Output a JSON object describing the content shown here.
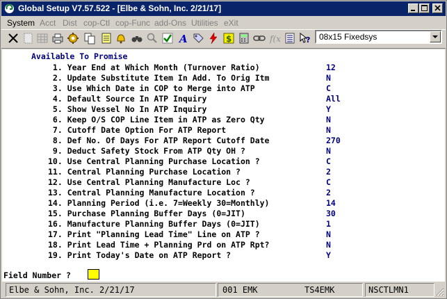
{
  "window": {
    "title": "Global Setup V7.57.522 - [Elbe & Sohn, Inc. 2/21/17]"
  },
  "menubar": {
    "items": [
      {
        "label": "System",
        "enabled": true
      },
      {
        "label": "Acct",
        "enabled": false
      },
      {
        "label": "Dist",
        "enabled": false
      },
      {
        "label": "cop-Ctl",
        "enabled": false
      },
      {
        "label": "cop-Func",
        "enabled": false
      },
      {
        "label": "add-Ons",
        "enabled": false
      },
      {
        "label": "Utilities",
        "enabled": false
      },
      {
        "label": "eXit",
        "enabled": false
      }
    ]
  },
  "toolbar": {
    "font_select": "08x15 Fixedsys"
  },
  "screen": {
    "heading": "Available To Promise",
    "rows": [
      {
        "q": " 1. Year End at Which Month (Turnover Ratio)",
        "v": "12"
      },
      {
        "q": " 2. Update Substitute Item In Add. To Orig Itm",
        "v": "N"
      },
      {
        "q": " 3. Use Which Date in COP to Merge into ATP",
        "v": "C"
      },
      {
        "q": " 4. Default Source In ATP Inquiry",
        "v": "All"
      },
      {
        "q": " 5. Show Vessel No In ATP Inquiry",
        "v": "Y"
      },
      {
        "q": " 6. Keep O/S COP Line Item in ATP as Zero Qty",
        "v": "N"
      },
      {
        "q": " 7. Cutoff Date Option For ATP Report",
        "v": "N"
      },
      {
        "q": " 8. Def No. Of Days For ATP Report Cutoff Date",
        "v": "270"
      },
      {
        "q": " 9. Deduct Safety Stock From ATP Qty OH ?",
        "v": "N"
      },
      {
        "q": "10. Use Central Planning Purchase Location ?",
        "v": "C"
      },
      {
        "q": "11. Central Planning Purchase Location ?",
        "v": "2"
      },
      {
        "q": "12. Use Central Planning Manufacture Loc ?",
        "v": "C"
      },
      {
        "q": "13. Central Planning Manufacture Location ?",
        "v": "2"
      },
      {
        "q": "14. Planning Period (i.e. 7=Weekly 30=Monthly)",
        "v": "14"
      },
      {
        "q": "15. Purchase Planning Buffer Days (0=JIT)",
        "v": "30"
      },
      {
        "q": "16. Manufacture Planning Buffer Days (0=JIT)",
        "v": "1"
      },
      {
        "q": "17. Print \"Planning Lead Time\" Line on ATP ?",
        "v": "N"
      },
      {
        "q": "18. Print Lead Time + Planning Prd on ATP Rpt?",
        "v": "N"
      },
      {
        "q": "19. Print Today's Date on ATP Report ?",
        "v": "Y"
      }
    ],
    "prompt": "Field Number ?"
  },
  "statusbar": {
    "company": "Elbe & Sohn, Inc. 2/21/17",
    "user": "001 EMK",
    "terminal": "TS4EMK",
    "program": "NSCTLMN1"
  },
  "colors": {
    "title_bg": "#0a246a",
    "field_value": "#000080",
    "cursor": "#ffff00"
  }
}
